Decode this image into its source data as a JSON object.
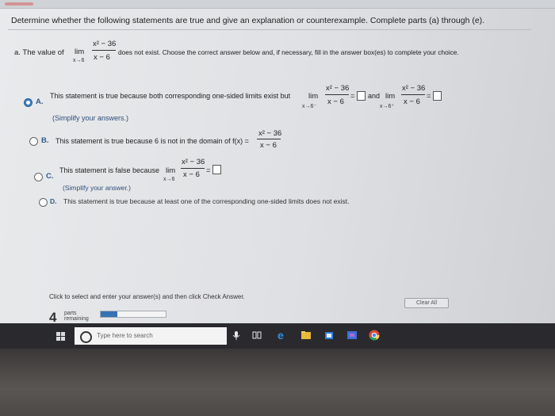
{
  "instruction": "Determine whether the following statements are true and give an explanation or counterexample. Complete parts (a) through (e).",
  "part_a": {
    "prefix": "a. The value of",
    "lim": "lim",
    "approach": "x→6",
    "numerator": "x² − 36",
    "denominator": "x − 6",
    "suffix": "does not exist. Choose the correct answer below and, if necessary, fill in the answer box(es) to complete your choice."
  },
  "options": [
    {
      "letter": "A.",
      "selected": true,
      "text": "This statement is true because both corresponding one-sided limits exist but",
      "lim": "lim",
      "approach_left": "x→6⁻",
      "approach_right": "x→6⁺",
      "numerator": "x² − 36",
      "denominator": "x − 6",
      "and": "and",
      "hint": "(Simplify your answers.)"
    },
    {
      "letter": "B.",
      "selected": false,
      "text": "This statement is true because 6 is not in the domain of f(x) =",
      "numerator": "x² − 36",
      "denominator": "x − 6"
    },
    {
      "letter": "C.",
      "selected": false,
      "text": "This statement is false because",
      "lim": "lim",
      "approach": "x→6",
      "numerator": "x² − 36",
      "denominator": "x − 6",
      "hint": "(Simplify your answer.)"
    },
    {
      "letter": "D.",
      "selected": false,
      "text": "This statement is true because at least one of the corresponding one-sided limits does not exist."
    }
  ],
  "footer": {
    "check_hint": "Click to select and enter your answer(s) and then click Check Answer.",
    "clear_all": "Clear All",
    "parts_count": "4",
    "parts_label_1": "parts",
    "parts_label_2": "remaining",
    "progress_fraction": 0.25
  },
  "taskbar": {
    "search_placeholder": "Type here to search",
    "icons": [
      "windows-icon",
      "cortana-icon",
      "mic-icon",
      "task-view-icon",
      "edge-icon",
      "file-explorer-icon",
      "store-icon",
      "app-icon",
      "chrome-icon"
    ]
  },
  "colors": {
    "accent": "#3b7fc4",
    "option_letter": "#2d5b8f",
    "taskbar": "#2a2a2e"
  }
}
